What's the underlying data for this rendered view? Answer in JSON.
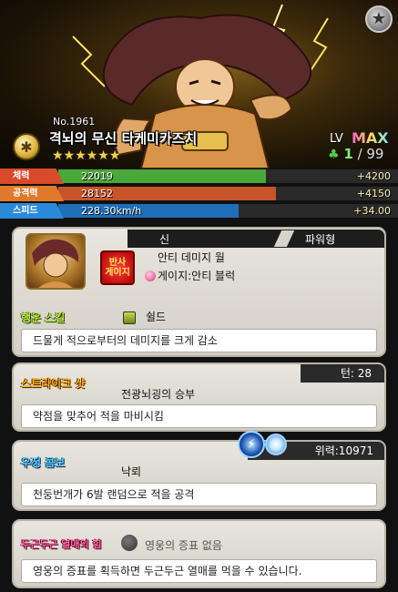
{
  "character": {
    "number": "No.1961",
    "name": "격뇌의 무신 타케미카즈치",
    "stars": "★★★★★★",
    "level_label": "LV",
    "level_max_label": "MAX",
    "level_current": "1",
    "level_cap": "/ 99"
  },
  "stats": [
    {
      "label": "체력",
      "value": "22019",
      "bonus": "+4200",
      "fill": 0.61,
      "tag_color": "#d94a2a",
      "fill_color": "#4aa83a"
    },
    {
      "label": "공격력",
      "value": "28152",
      "bonus": "+4150",
      "fill": 0.64,
      "tag_color": "#e07a2a",
      "fill_color": "#c8542a"
    },
    {
      "label": "스피드",
      "value": "228.30km/h",
      "bonus": "+34.00",
      "fill": 0.53,
      "tag_color": "#2a8ad9",
      "fill_color": "#1f6fb8"
    }
  ],
  "info": {
    "race": "신",
    "type": "파워형",
    "ability_icon_text": "반사\n게이지",
    "ability_name": "안티 데미지 월",
    "gauge_text": "게이지:안티 블럭",
    "luck_label": "행운 스킬",
    "luck_name": "쉴드",
    "luck_desc": "드물게 적으로부터의 데미지를 크게 감소"
  },
  "strike": {
    "label": "스트라이크 샷",
    "turns": "턴: 28",
    "name": "전광뇌굉의 승부",
    "desc": "약점을 맞추어 적을 마비시킴"
  },
  "friendship": {
    "label": "우정 콤보",
    "power": "위력:10971",
    "name": "낙뢰",
    "desc": "천둥번개가 6발 랜덤으로 적을 공격"
  },
  "heart": {
    "label": "두근두근 열매의 힘",
    "status": "영웅의 증표 없음",
    "desc": "영웅의 증표를 획득하면 두근두근 열매를 먹을 수 있습니다."
  },
  "icons": {
    "settings": "star-settings-icon",
    "medal": "rank-medal-icon",
    "clover": "clover-icon",
    "gauge": "gauge-dot-icon",
    "luck": "shield-skill-icon",
    "orb": "lightning-orb-icon"
  }
}
